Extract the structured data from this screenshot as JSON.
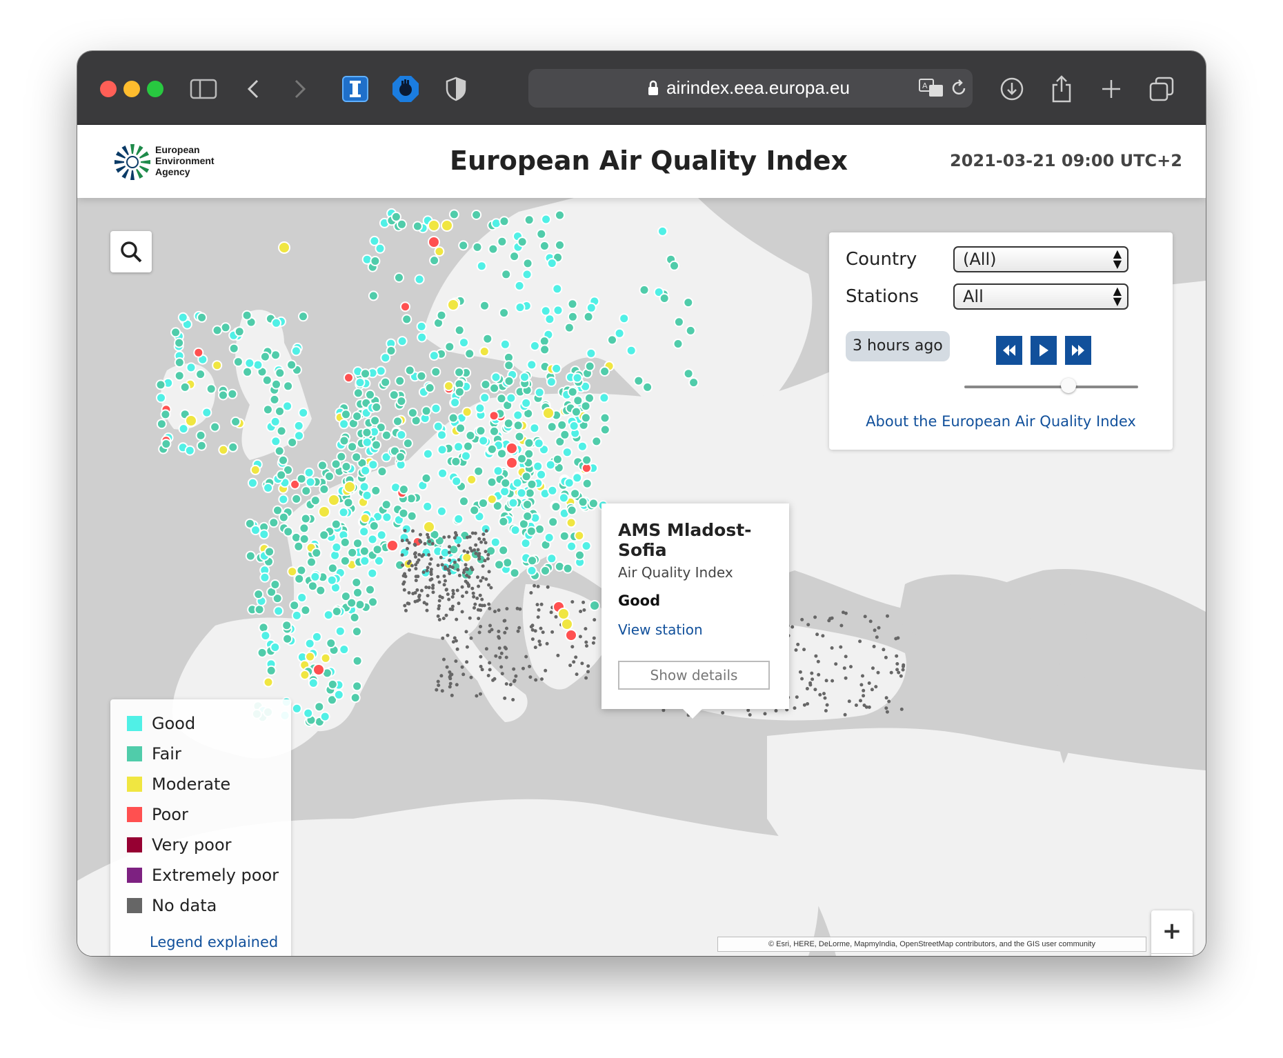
{
  "browser": {
    "url": "airindex.eea.europa.eu"
  },
  "header": {
    "logo_lines": [
      "European",
      "Environment",
      "Agency"
    ],
    "title": "European Air Quality Index",
    "timestamp": "2021-03-21 09:00 UTC+2"
  },
  "panel": {
    "country_label": "Country",
    "country_value": "(All)",
    "stations_label": "Stations",
    "stations_value": "All",
    "time_ago": "3 hours ago",
    "about_link": "About the European Air Quality Index",
    "time_slider_fraction": 0.6
  },
  "popup": {
    "station_name": "AMS Mladost-Sofia",
    "index_label": "Air Quality Index",
    "index_value": "Good",
    "view_link": "View station",
    "details_button": "Show details"
  },
  "legend": {
    "items": [
      {
        "label": "Good",
        "color": "#50f0e6"
      },
      {
        "label": "Fair",
        "color": "#50ccaa"
      },
      {
        "label": "Moderate",
        "color": "#f0e641"
      },
      {
        "label": "Poor",
        "color": "#ff5050"
      },
      {
        "label": "Very poor",
        "color": "#960032"
      },
      {
        "label": "Extremely poor",
        "color": "#7d2181"
      },
      {
        "label": "No data",
        "color": "#666666"
      }
    ],
    "link": "Legend explained"
  },
  "zoom": {
    "plus": "+",
    "minus": "-"
  },
  "attribution": "© Esri, HERE, DeLorme, MapmyIndia, OpenStreetMap contributors, and the GIS user community",
  "icons": [
    "sidebar-icon",
    "back-icon",
    "forward-icon",
    "reader-icon",
    "hand-icon",
    "shield-icon",
    "lock-icon",
    "translate-icon",
    "reload-icon",
    "download-icon",
    "share-icon",
    "plus-icon",
    "tabs-icon",
    "search-icon",
    "rewind-icon",
    "play-icon",
    "fast-forward-icon"
  ]
}
